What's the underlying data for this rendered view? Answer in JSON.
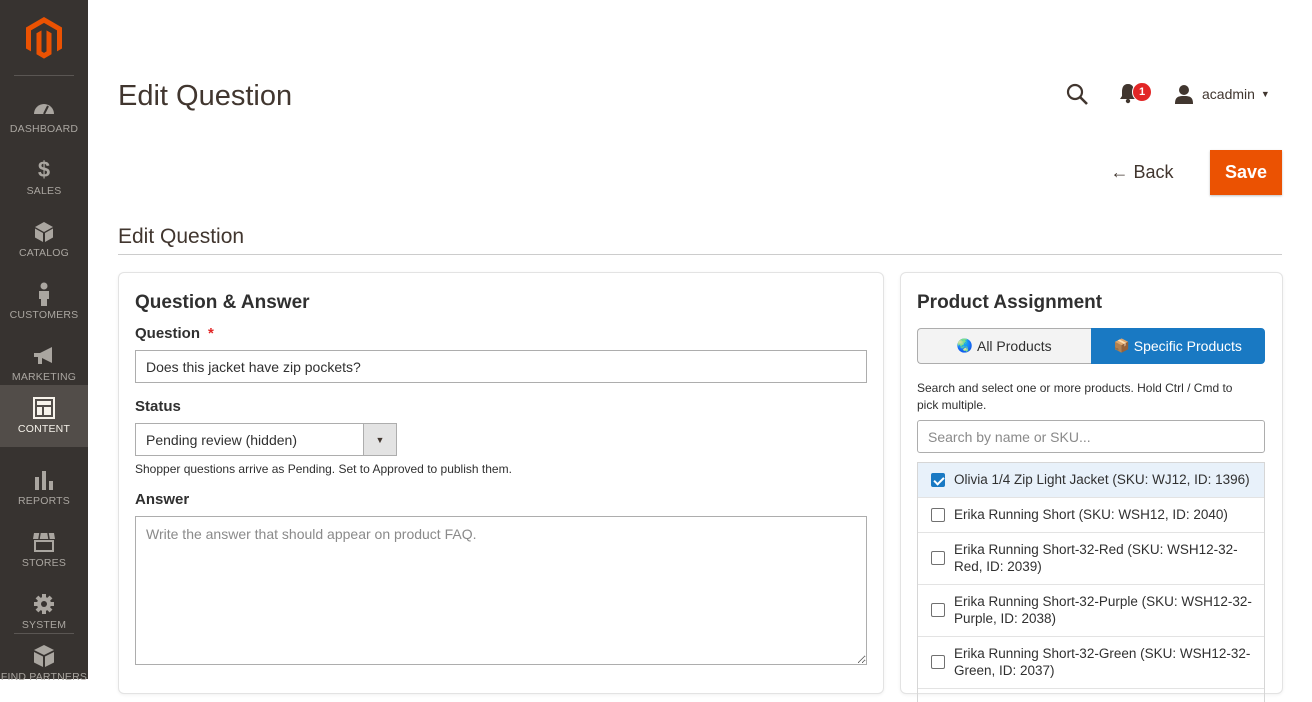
{
  "colors": {
    "sidebar": "#373330",
    "accent": "#eb5202",
    "primary": "#1979c3",
    "badge": "#e22626"
  },
  "sidebar": {
    "items": [
      {
        "label": "DASHBOARD",
        "icon": "dashboard-icon"
      },
      {
        "label": "SALES",
        "icon": "dollar-icon"
      },
      {
        "label": "CATALOG",
        "icon": "cube-icon"
      },
      {
        "label": "CUSTOMERS",
        "icon": "person-icon"
      },
      {
        "label": "MARKETING",
        "icon": "megaphone-icon"
      },
      {
        "label": "CONTENT",
        "icon": "layout-icon",
        "active": true
      },
      {
        "label": "REPORTS",
        "icon": "bar-chart-icon"
      },
      {
        "label": "STORES",
        "icon": "storefront-icon"
      },
      {
        "label": "SYSTEM",
        "icon": "gear-icon"
      },
      {
        "label": "FIND PARTNERS",
        "icon": "boxes-icon"
      }
    ]
  },
  "header": {
    "title": "Edit Question",
    "notifications_count": "1",
    "user_name": "acadmin"
  },
  "actions": {
    "back_label": "← Back",
    "save_label": "Save"
  },
  "section_title": "Edit Question",
  "qa": {
    "heading": "Question & Answer",
    "question_label": "Question",
    "required_mark": "*",
    "question_value": "Does this jacket have zip pockets?",
    "status_label": "Status",
    "status_value": "Pending review (hidden)",
    "status_help": "Shopper questions arrive as Pending. Set to Approved to publish them.",
    "answer_label": "Answer",
    "answer_placeholder": "Write the answer that should appear on product FAQ."
  },
  "assignment": {
    "heading": "Product Assignment",
    "all_label": "All Products",
    "specific_label": "Specific Products",
    "help": "Search and select one or more products. Hold Ctrl / Cmd to pick multiple.",
    "search_placeholder": "Search by name or SKU...",
    "products": [
      {
        "label": "Olivia 1/4 Zip Light Jacket (SKU: WJ12, ID: 1396)",
        "checked": true
      },
      {
        "label": "Erika Running Short (SKU: WSH12, ID: 2040)",
        "checked": false
      },
      {
        "label": "Erika Running Short-32-Red (SKU: WSH12-32-Red, ID: 2039)",
        "checked": false
      },
      {
        "label": "Erika Running Short-32-Purple (SKU: WSH12-32-Purple, ID: 2038)",
        "checked": false
      },
      {
        "label": "Erika Running Short-32-Green (SKU: WSH12-32-Green, ID: 2037)",
        "checked": false
      }
    ]
  }
}
